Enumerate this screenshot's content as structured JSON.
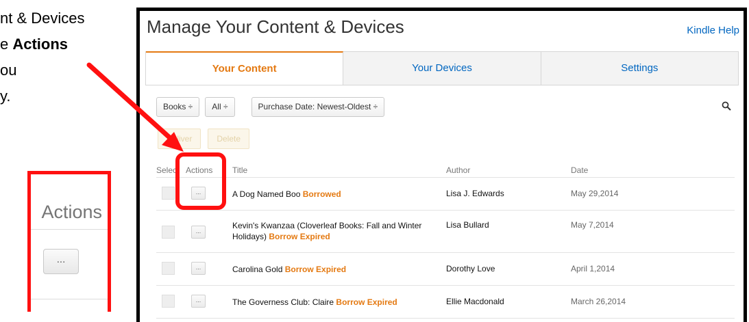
{
  "instructions": {
    "line1": "nt & Devices",
    "line2_prefix": "e ",
    "line2_bold": "Actions",
    "line3": "ou",
    "line4": "y."
  },
  "zoom": {
    "label": "Actions",
    "button": "..."
  },
  "header": {
    "title": "Manage Your Content & Devices",
    "help": "Kindle Help"
  },
  "tabs": [
    {
      "label": "Your Content",
      "active": true
    },
    {
      "label": "Your Devices",
      "active": false
    },
    {
      "label": "Settings",
      "active": false
    }
  ],
  "filters": {
    "type": "Books ÷",
    "scope": "All ÷",
    "sort": "Purchase Date: Newest-Oldest ÷"
  },
  "bulk_actions": {
    "deliver": "Deliver",
    "delete": "Delete"
  },
  "table": {
    "columns": {
      "select": "Select",
      "actions": "Actions",
      "title": "Title",
      "author": "Author",
      "date": "Date"
    },
    "rows": [
      {
        "title": "A Dog Named Boo",
        "status": "Borrowed",
        "author": "Lisa J. Edwards",
        "date": "May 29,2014",
        "button": "..."
      },
      {
        "title": "Kevin's Kwanzaa (Cloverleaf Books: Fall and Winter Holidays)",
        "status": "Borrow Expired",
        "author": "Lisa Bullard",
        "date": "May 7,2014",
        "button": "..."
      },
      {
        "title": "Carolina Gold",
        "status": "Borrow Expired",
        "author": "Dorothy Love",
        "date": "April 1,2014",
        "button": "..."
      },
      {
        "title": "The Governess Club: Claire",
        "status": "Borrow Expired",
        "author": "Ellie Macdonald",
        "date": "March 26,2014",
        "button": "..."
      }
    ]
  },
  "colors": {
    "annotation": "#ff1010",
    "accent": "#e47911",
    "link": "#0066c0"
  }
}
